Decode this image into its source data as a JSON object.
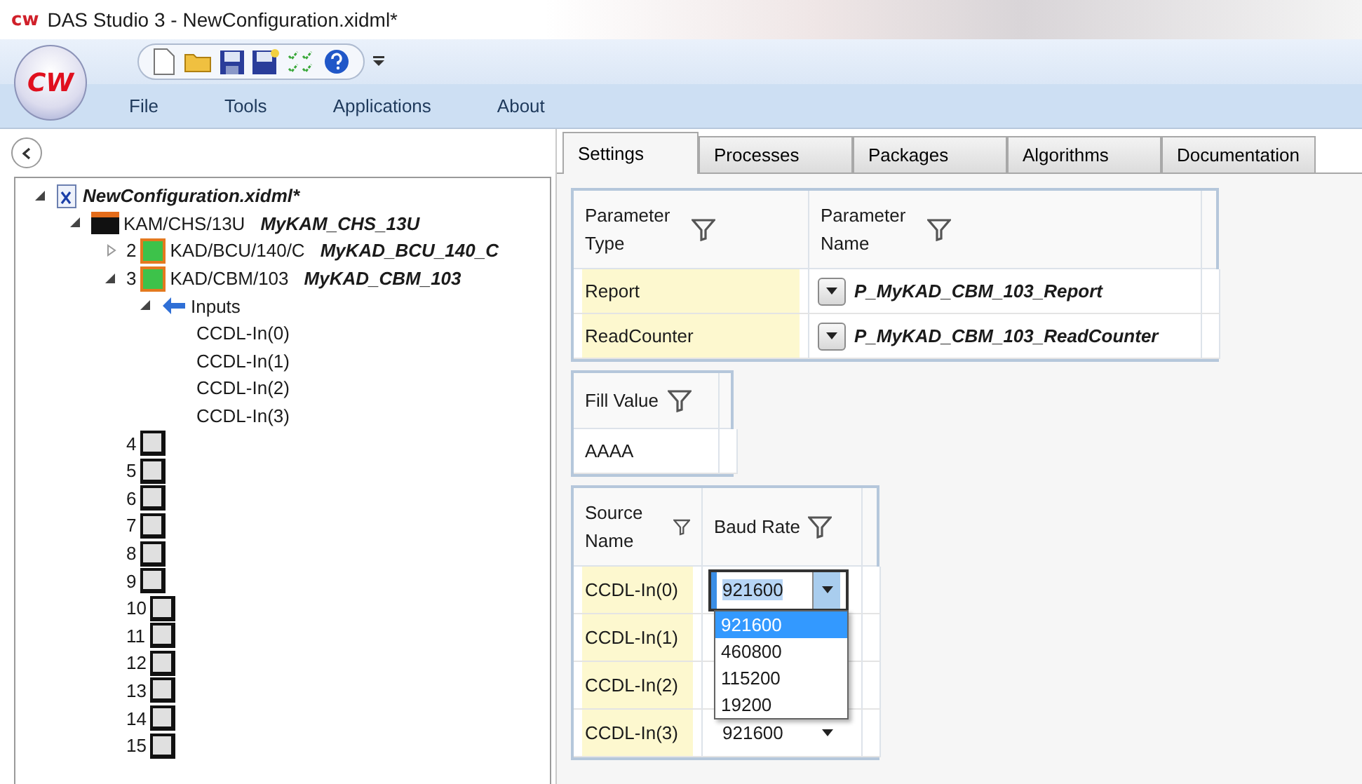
{
  "window": {
    "title": "DAS Studio 3 - NewConfiguration.xidml*",
    "logo": "cw"
  },
  "ribbon": {
    "orb": "CW",
    "menu": [
      {
        "label": "File"
      },
      {
        "label": "Tools"
      },
      {
        "label": "Applications"
      },
      {
        "label": "About"
      }
    ]
  },
  "tree": [
    {
      "kind": "file",
      "label": "NewConfiguration.xidml*",
      "expanded": true,
      "children": [
        {
          "kind": "chassis",
          "label": "KAM/CHS/13U",
          "alias": "MyKAM_CHS_13U",
          "expanded": true,
          "children": [
            {
              "kind": "module",
              "number": "2",
              "label": "KAD/BCU/140/C",
              "alias": "MyKAD_BCU_140_C",
              "expanded": false
            },
            {
              "kind": "module",
              "number": "3",
              "label": "KAD/CBM/103",
              "alias": "MyKAD_CBM_103",
              "expanded": true,
              "children": [
                {
                  "kind": "inputs",
                  "label": "Inputs",
                  "expanded": true,
                  "children": [
                    {
                      "kind": "channel",
                      "label": "CCDL-In(0)"
                    },
                    {
                      "kind": "channel",
                      "label": "CCDL-In(1)"
                    },
                    {
                      "kind": "channel",
                      "label": "CCDL-In(2)"
                    },
                    {
                      "kind": "channel",
                      "label": "CCDL-In(3)"
                    }
                  ]
                }
              ]
            },
            {
              "kind": "slot",
              "number": "4"
            },
            {
              "kind": "slot",
              "number": "5"
            },
            {
              "kind": "slot",
              "number": "6"
            },
            {
              "kind": "slot",
              "number": "7"
            },
            {
              "kind": "slot",
              "number": "8"
            },
            {
              "kind": "slot",
              "number": "9"
            },
            {
              "kind": "slot",
              "number": "10"
            },
            {
              "kind": "slot",
              "number": "11"
            },
            {
              "kind": "slot",
              "number": "12"
            },
            {
              "kind": "slot",
              "number": "13"
            },
            {
              "kind": "slot",
              "number": "14"
            },
            {
              "kind": "slot",
              "number": "15"
            }
          ]
        }
      ]
    }
  ],
  "tabs": [
    {
      "label": "Settings",
      "selected": true
    },
    {
      "label": "Processes",
      "selected": false
    },
    {
      "label": "Packages",
      "selected": false
    },
    {
      "label": "Algorithms",
      "selected": false
    },
    {
      "label": "Documentation",
      "selected": false
    }
  ],
  "parameter_table": {
    "columns": [
      "Parameter Type",
      "Parameter Name"
    ],
    "rows": [
      {
        "type": "Report",
        "name": "P_MyKAD_CBM_103_Report"
      },
      {
        "type": "ReadCounter",
        "name": "P_MyKAD_CBM_103_ReadCounter"
      }
    ]
  },
  "fill_table": {
    "columns": [
      "Fill Value"
    ],
    "rows": [
      {
        "value": "AAAA"
      }
    ]
  },
  "source_table": {
    "columns": [
      "Source Name",
      "Baud Rate"
    ],
    "rows": [
      {
        "source": "CCDL-In(0)",
        "baud": "921600",
        "editing": true
      },
      {
        "source": "CCDL-In(1)",
        "editing": false
      },
      {
        "source": "CCDL-In(2)",
        "editing": false
      },
      {
        "source": "CCDL-In(3)",
        "baud": "921600",
        "editing": false
      }
    ],
    "dropdown": [
      {
        "label": "921600",
        "selected": true
      },
      {
        "label": "460800",
        "selected": false
      },
      {
        "label": "115200",
        "selected": false
      },
      {
        "label": "19200",
        "selected": false
      }
    ]
  }
}
